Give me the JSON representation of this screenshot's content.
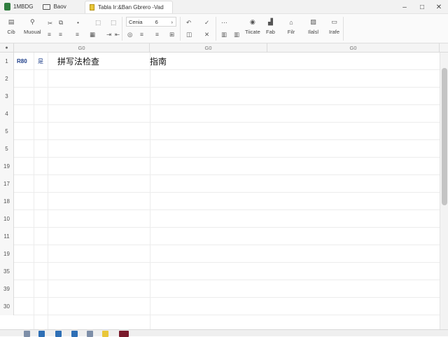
{
  "titlebar": {
    "app_name": "1MBDG",
    "home_tab": "Baov",
    "doc_tab": "Tabla Ir:&Ban Gbrero -Vad"
  },
  "toolbar": {
    "items": [
      {
        "label": "Cib"
      },
      {
        "label": "Muoual"
      },
      {
        "label": "Tiicate"
      },
      {
        "label": "Fab"
      },
      {
        "label": "Filr"
      },
      {
        "label": "Ilalsl"
      },
      {
        "label": "Irafe"
      }
    ],
    "font_name": "Cenia",
    "font_size": "6"
  },
  "columns": [
    "G0",
    "G0",
    "G0"
  ],
  "rows": [
    "1",
    "2",
    "3",
    "4",
    "5",
    "5",
    "19",
    "17",
    "18",
    "10",
    "11",
    "19",
    "35",
    "39",
    "30"
  ],
  "row1": {
    "a": "R80",
    "b": "是",
    "c": "拼写法检查",
    "d": "指南"
  },
  "colors": {
    "accent_green": "#2f7d3e",
    "doc_yellow": "#e9c73a",
    "sheet_blue": "#2e6fb5",
    "sheet_maroon": "#7a1a2c"
  }
}
